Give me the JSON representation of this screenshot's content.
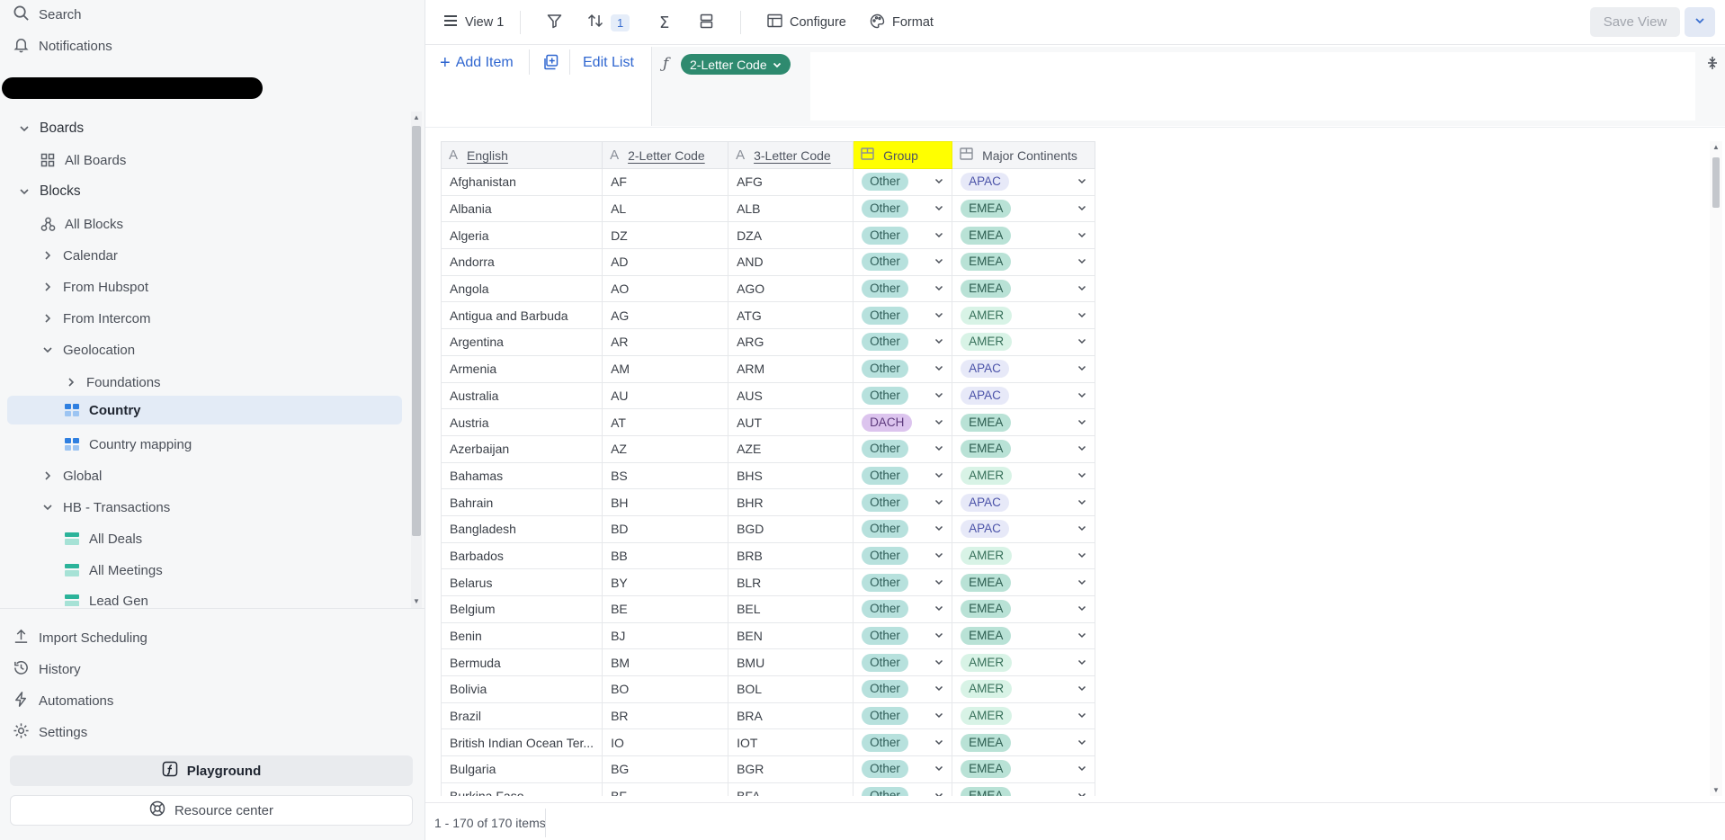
{
  "sidebar": {
    "search_label": "Search",
    "notifications_label": "Notifications",
    "boards_label": "Boards",
    "all_boards_label": "All Boards",
    "blocks_label": "Blocks",
    "all_blocks_label": "All Blocks",
    "calendar_label": "Calendar",
    "from_hubspot_label": "From Hubspot",
    "from_intercom_label": "From Intercom",
    "geolocation_label": "Geolocation",
    "foundations_label": "Foundations",
    "country_label": "Country",
    "country_mapping_label": "Country mapping",
    "global_label": "Global",
    "hb_transactions_label": "HB - Transactions",
    "all_deals_label": "All Deals",
    "all_meetings_label": "All Meetings",
    "lead_gen_label": "Lead Gen",
    "import_scheduling_label": "Import Scheduling",
    "history_label": "History",
    "automations_label": "Automations",
    "settings_label": "Settings",
    "playground_label": "Playground",
    "resource_center_label": "Resource center"
  },
  "toolbar": {
    "view_label": "View 1",
    "sort_count": "1",
    "configure_label": "Configure",
    "format_label": "Format",
    "save_view_label": "Save View"
  },
  "actions": {
    "add_item_label": "Add Item",
    "edit_list_label": "Edit List",
    "formula_field_label": "2-Letter Code"
  },
  "grid": {
    "columns": {
      "english": "English",
      "code2": "2-Letter Code",
      "code3": "3-Letter Code",
      "group": "Group",
      "continents": "Major Continents"
    },
    "rows": [
      {
        "english": "Afghanistan",
        "code2": "AF",
        "code3": "AFG",
        "group": "Other",
        "continent": "APAC"
      },
      {
        "english": "Albania",
        "code2": "AL",
        "code3": "ALB",
        "group": "Other",
        "continent": "EMEA"
      },
      {
        "english": "Algeria",
        "code2": "DZ",
        "code3": "DZA",
        "group": "Other",
        "continent": "EMEA"
      },
      {
        "english": "Andorra",
        "code2": "AD",
        "code3": "AND",
        "group": "Other",
        "continent": "EMEA"
      },
      {
        "english": "Angola",
        "code2": "AO",
        "code3": "AGO",
        "group": "Other",
        "continent": "EMEA"
      },
      {
        "english": "Antigua and Barbuda",
        "code2": "AG",
        "code3": "ATG",
        "group": "Other",
        "continent": "AMER"
      },
      {
        "english": "Argentina",
        "code2": "AR",
        "code3": "ARG",
        "group": "Other",
        "continent": "AMER"
      },
      {
        "english": "Armenia",
        "code2": "AM",
        "code3": "ARM",
        "group": "Other",
        "continent": "APAC"
      },
      {
        "english": "Australia",
        "code2": "AU",
        "code3": "AUS",
        "group": "Other",
        "continent": "APAC"
      },
      {
        "english": "Austria",
        "code2": "AT",
        "code3": "AUT",
        "group": "DACH",
        "continent": "EMEA"
      },
      {
        "english": "Azerbaijan",
        "code2": "AZ",
        "code3": "AZE",
        "group": "Other",
        "continent": "EMEA"
      },
      {
        "english": "Bahamas",
        "code2": "BS",
        "code3": "BHS",
        "group": "Other",
        "continent": "AMER"
      },
      {
        "english": "Bahrain",
        "code2": "BH",
        "code3": "BHR",
        "group": "Other",
        "continent": "APAC"
      },
      {
        "english": "Bangladesh",
        "code2": "BD",
        "code3": "BGD",
        "group": "Other",
        "continent": "APAC"
      },
      {
        "english": "Barbados",
        "code2": "BB",
        "code3": "BRB",
        "group": "Other",
        "continent": "AMER"
      },
      {
        "english": "Belarus",
        "code2": "BY",
        "code3": "BLR",
        "group": "Other",
        "continent": "EMEA"
      },
      {
        "english": "Belgium",
        "code2": "BE",
        "code3": "BEL",
        "group": "Other",
        "continent": "EMEA"
      },
      {
        "english": "Benin",
        "code2": "BJ",
        "code3": "BEN",
        "group": "Other",
        "continent": "EMEA"
      },
      {
        "english": "Bermuda",
        "code2": "BM",
        "code3": "BMU",
        "group": "Other",
        "continent": "AMER"
      },
      {
        "english": "Bolivia",
        "code2": "BO",
        "code3": "BOL",
        "group": "Other",
        "continent": "AMER"
      },
      {
        "english": "Brazil",
        "code2": "BR",
        "code3": "BRA",
        "group": "Other",
        "continent": "AMER"
      },
      {
        "english": "British Indian Ocean Ter...",
        "code2": "IO",
        "code3": "IOT",
        "group": "Other",
        "continent": "EMEA"
      },
      {
        "english": "Bulgaria",
        "code2": "BG",
        "code3": "BGR",
        "group": "Other",
        "continent": "EMEA"
      },
      {
        "english": "Burkina Faso",
        "code2": "BF",
        "code3": "BFA",
        "group": "Other",
        "continent": "EMEA"
      }
    ]
  },
  "tag_colors": {
    "Other": {
      "bg": "#b7e1dd",
      "fg": "#2f5d58"
    },
    "DACH": {
      "bg": "#dcc4ee",
      "fg": "#5d3a7c"
    },
    "APAC": {
      "bg": "#e7e9f8",
      "fg": "#4a52a8"
    },
    "EMEA": {
      "bg": "#b9e2d6",
      "fg": "#2b5c4f"
    },
    "AMER": {
      "bg": "#d8f3e6",
      "fg": "#37705a"
    }
  },
  "footer": {
    "count_label": "1 - 170 of 170 items"
  }
}
